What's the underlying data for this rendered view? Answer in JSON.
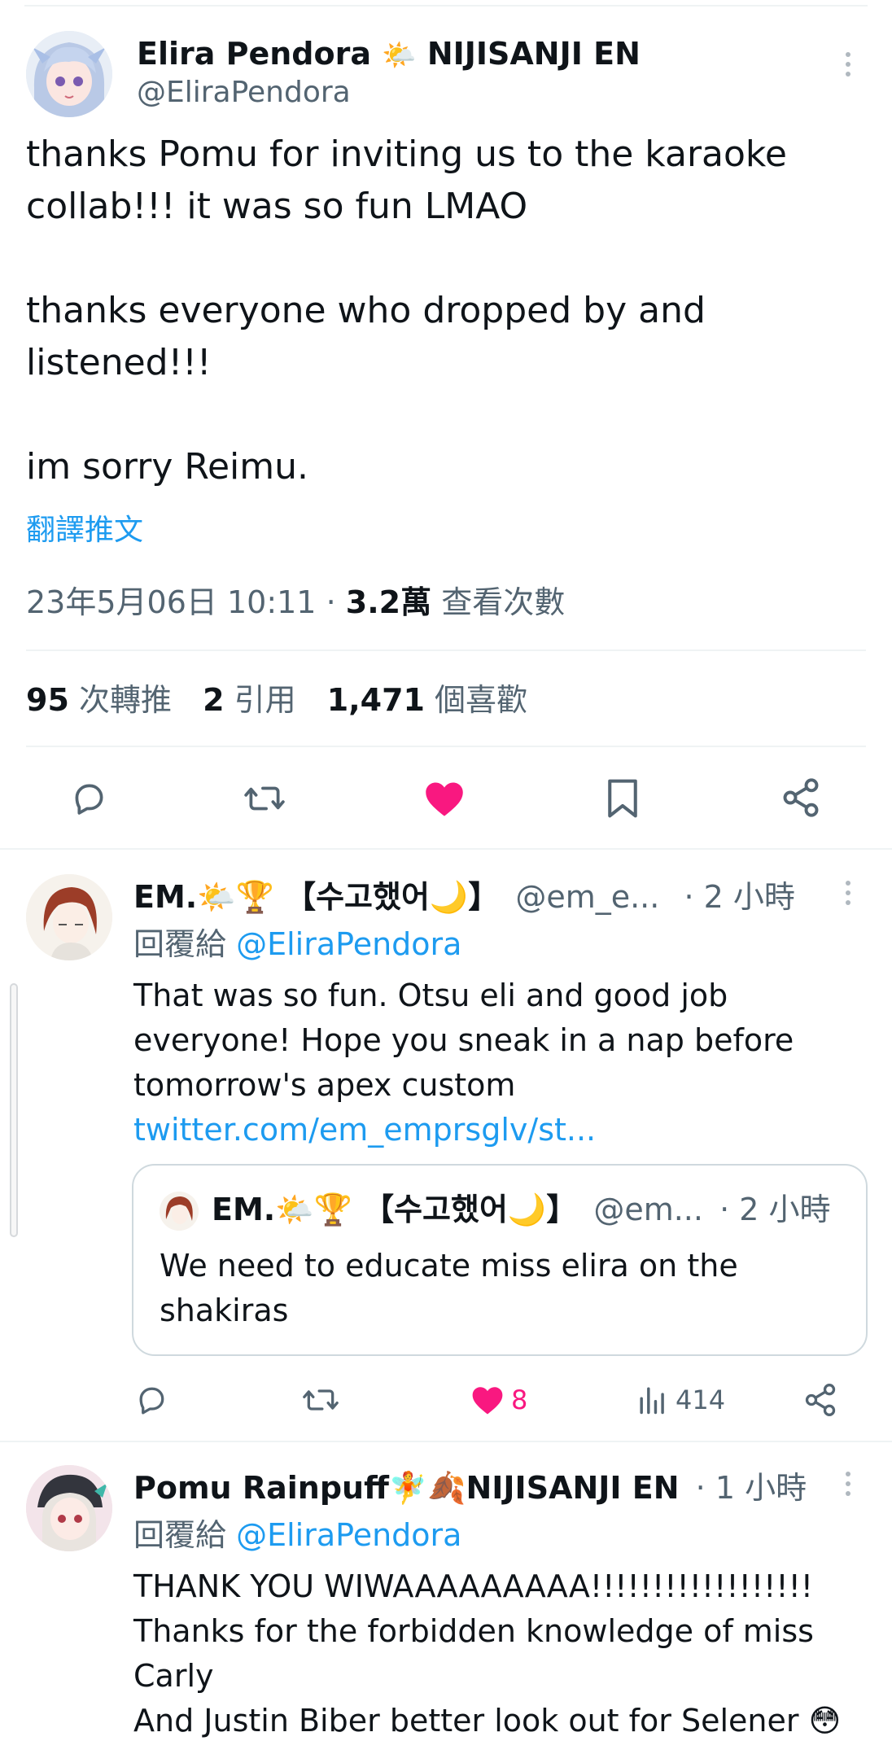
{
  "main_tweet": {
    "display_name": "Elira Pendora",
    "name_suffix": "NIJISANJI EN",
    "handle": "@EliraPendora",
    "text_lines": [
      "thanks Pomu for inviting us to the karaoke",
      "collab!!! it was so fun LMAO",
      "thanks everyone who dropped by and",
      "listened!!!",
      "im sorry Reimu."
    ],
    "translate_label": "翻譯推文",
    "timestamp": "23年5月06日 10:11",
    "separator": "·",
    "views_count": "3.2萬",
    "views_label": "查看次數",
    "stats": {
      "retweets_count": "95",
      "retweets_label": "次轉推",
      "quotes_count": "2",
      "quotes_label": "引用",
      "likes_count": "1,471",
      "likes_label": "個喜歡"
    },
    "icons": [
      "reply-icon",
      "retweet-icon",
      "like-icon",
      "bookmark-icon",
      "share-icon"
    ]
  },
  "replies": [
    {
      "display_name": "EM.🌤️🏆 【수고했어🌙】",
      "handle": "@em_e...",
      "time": "· 2 小時",
      "reply_to_label": "回覆給",
      "reply_to_handle": "@EliraPendora",
      "text_lines": [
        "That was so fun. Otsu eli and good job",
        "everyone! Hope you sneak in a nap before",
        "tomorrow's apex custom"
      ],
      "link": "twitter.com/em_emprsglv/st...",
      "quote": {
        "display_name": "EM.🌤️🏆 【수고했어🌙】",
        "handle": "@em...",
        "time": "· 2 小時",
        "text_lines": [
          "We need to educate miss elira on the",
          "shakiras"
        ]
      },
      "likes": "8",
      "views": "414"
    },
    {
      "display_name": "Pomu Rainpuff🧚🍂NIJISANJI EN",
      "time": "· 1 小時",
      "reply_to_label": "回覆給",
      "reply_to_handle": "@EliraPendora",
      "text_lines": [
        "THANK YOU WIWAAAAAAAAA!!!!!!!!!!!!!!!!!!",
        "Thanks for the forbidden knowledge of miss",
        "Carly",
        "And Justin Biber better look out for Selener 😳"
      ]
    }
  ],
  "colors": {
    "like_pink": "#f91880",
    "link_blue": "#1d9bf0",
    "muted_gray": "#536471",
    "divider": "#eff3f4"
  }
}
